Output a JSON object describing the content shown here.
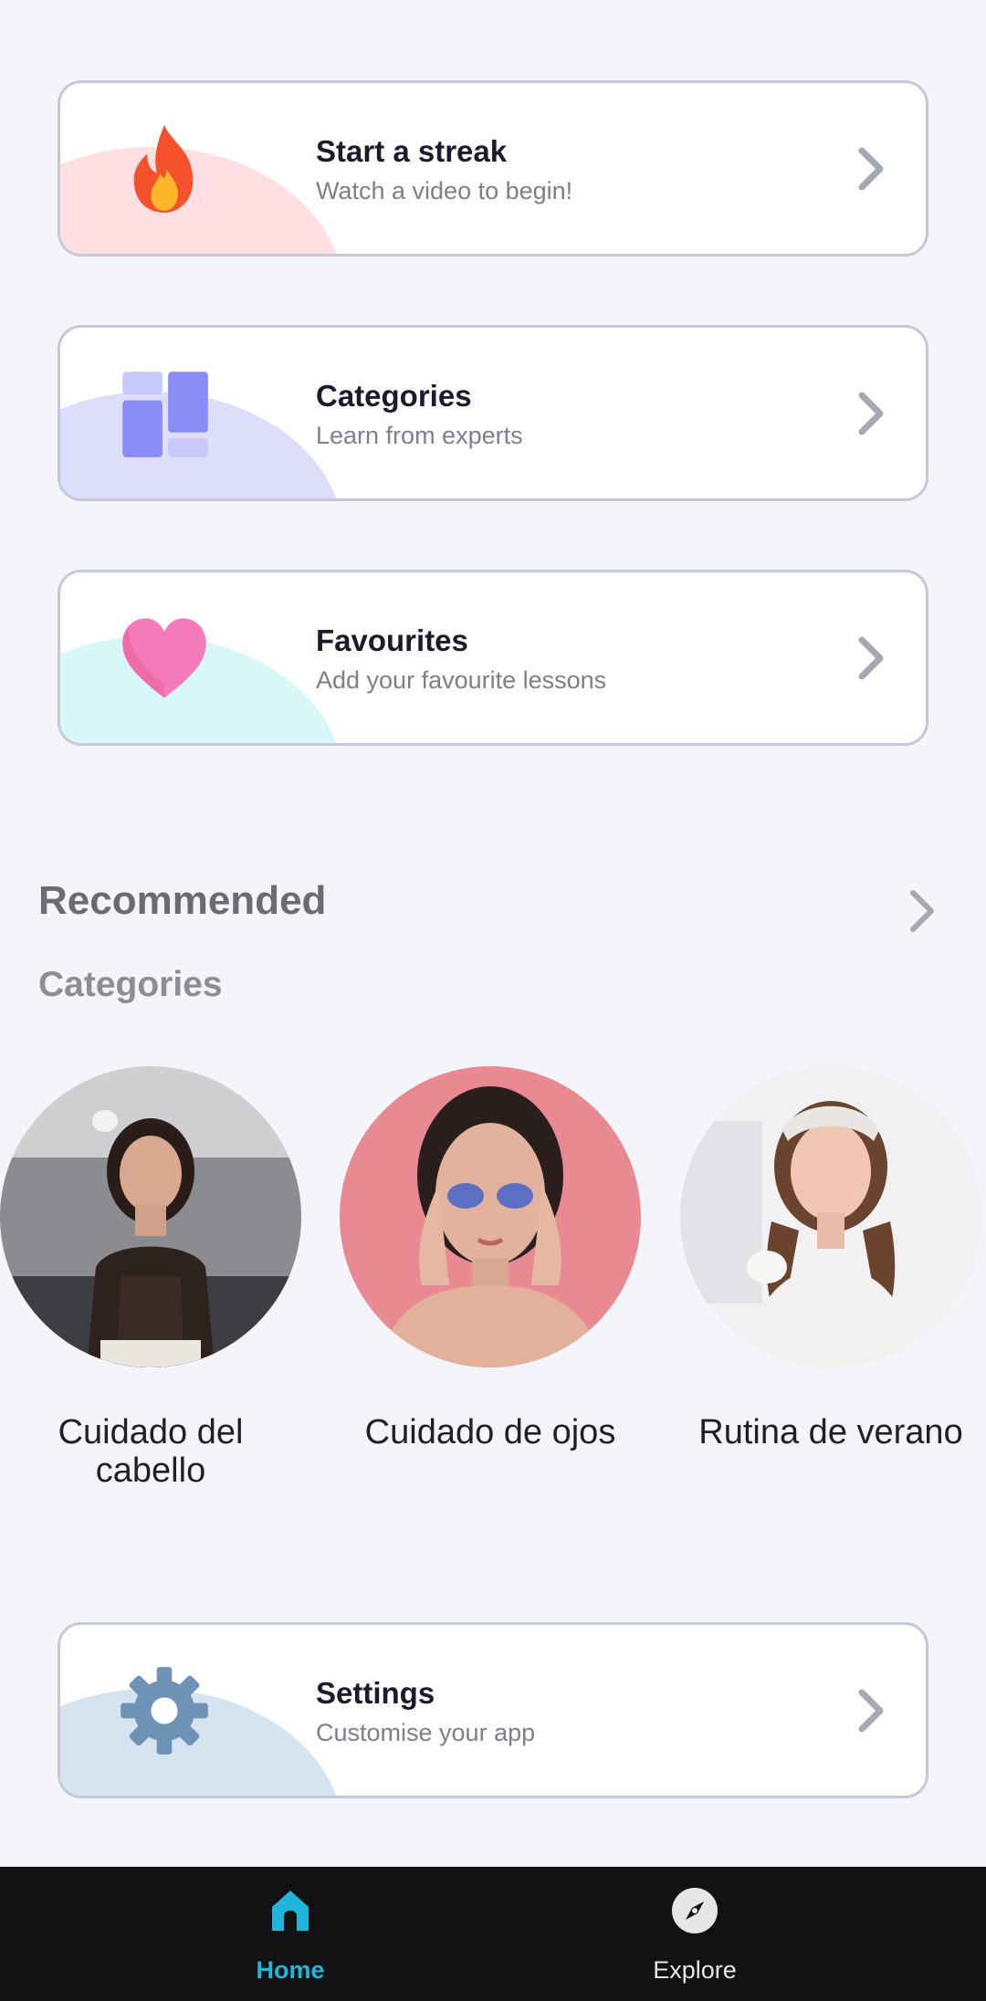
{
  "menu_cards": [
    {
      "title": "Start a streak",
      "subtitle": "Watch a video to begin!",
      "icon": "flame-icon",
      "blob_color": "#ffd9dd"
    },
    {
      "title": "Categories",
      "subtitle": "Learn from experts",
      "icon": "grid-icon",
      "blob_color": "#dcdcfb"
    },
    {
      "title": "Favourites",
      "subtitle": "Add your favourite lessons",
      "icon": "heart-icon",
      "blob_color": "#d5f6f8"
    }
  ],
  "recommended": {
    "title": "Recommended"
  },
  "categories_section": {
    "title": "Categories",
    "items": [
      {
        "label": "Cuidado del cabello"
      },
      {
        "label": "Cuidado de ojos"
      },
      {
        "label": "Rutina de verano"
      }
    ]
  },
  "settings_card": {
    "title": "Settings",
    "subtitle": "Customise your app",
    "icon": "gear-icon",
    "blob_color": "#d3e2ef"
  },
  "tabbar": {
    "tabs": [
      {
        "label": "Home",
        "icon": "home-icon",
        "active": true,
        "color": "#1fb6d9"
      },
      {
        "label": "Explore",
        "icon": "compass-icon",
        "active": false,
        "color": "#e6e6e6"
      }
    ]
  }
}
